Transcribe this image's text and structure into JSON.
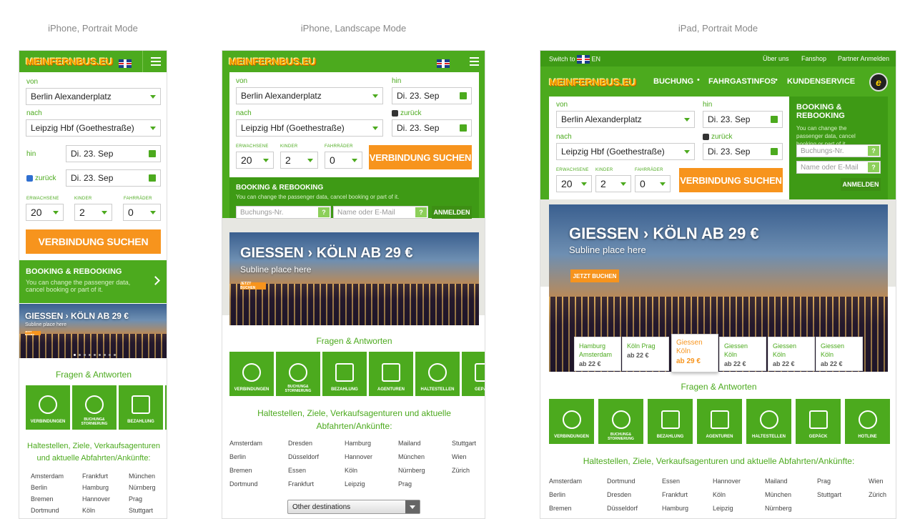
{
  "captions": {
    "p1": "iPhone, Portrait Mode",
    "p2": "iPhone, Landscape Mode",
    "p3": "iPad, Portrait Mode"
  },
  "logo": "MEINFERNBUS.EU",
  "form": {
    "von": "von",
    "nach": "nach",
    "hin": "hin",
    "zurueck": "zurück",
    "from_value": "Berlin Alexanderplatz",
    "to_value": "Leipzig Hbf (Goethestraße)",
    "date_out": "Di. 23. Sep",
    "date_back": "Di. 23. Sep",
    "adults_label": "ERWACHSENE",
    "kids_label": "KINDER",
    "bikes_label": "FAHRRÄDER",
    "adults": "20",
    "kids": "2",
    "bikes": "0",
    "search": "VERBINDUNG SUCHEN"
  },
  "booking": {
    "title": "BOOKING & REBOOKING",
    "text_long": "You can change the passenger data, cancel booking or part of it.",
    "text_p1a": "You can change the passenger data,",
    "text_p1b": "cancel booking or part of it.",
    "text_p3a": "You can change the",
    "text_p3b": "passenger data, cancel",
    "text_p3c": "booking or part of it.",
    "nr_ph": "Buchungs-Nr.",
    "name_ph": "Name oder E-Mail",
    "login": "ANMELDEN",
    "q": "?"
  },
  "hero": {
    "title": "GIESSEN › KÖLN",
    "price": "AB 29 €",
    "sub": "Subline place here",
    "cta": "JETZT BUCHEN"
  },
  "faq": "Fragen & Antworten",
  "tiles": [
    "VERBINDUNGEN",
    "BUCHUNG& STORNIERUNG",
    "BEZAHLUNG",
    "AGENTUREN",
    "HALTESTELLEN",
    "GEPÄCK",
    "HOTLINE"
  ],
  "stations_title": "Haltestellen, Ziele, Verkaufsagenturen und aktuelle Abfahrten/Ankünfte:",
  "stations_title_a": "Haltestellen, Ziele, Verkaufsagenturen und aktuelle",
  "stations_title_b": "Abfahrten/Ankünfte:",
  "stations_title_p1a": "Haltestellen, Ziele, Verkaufsagenturen",
  "stations_title_p1b": "und aktuelle Abfahrten/Ankünfte:",
  "dest_p1": [
    [
      "Amsterdam",
      "Frankfurt",
      "München"
    ],
    [
      "Berlin",
      "Hamburg",
      "Nürnberg"
    ],
    [
      "Bremen",
      "Hannover",
      "Prag"
    ],
    [
      "Dortmund",
      "Köln",
      "Stuttgart"
    ]
  ],
  "dest_p2": [
    [
      "Amsterdam",
      "Dresden",
      "Hamburg",
      "Mailand",
      "Stuttgart"
    ],
    [
      "Berlin",
      "Düsseldorf",
      "Hannover",
      "München",
      "Wien"
    ],
    [
      "Bremen",
      "Essen",
      "Köln",
      "Nürnberg",
      "Zürich"
    ],
    [
      "Dortmund",
      "Frankfurt",
      "Leipzig",
      "Prag",
      ""
    ]
  ],
  "dest_p3": [
    [
      "Amsterdam",
      "Dortmund",
      "Essen",
      "Hannover",
      "Mailand",
      "Prag",
      "Wien"
    ],
    [
      "Berlin",
      "Dresden",
      "Frankfurt",
      "Köln",
      "München",
      "Stuttgart",
      "Zürich"
    ],
    [
      "Bremen",
      "Düsseldorf",
      "Hamburg",
      "Leipzig",
      "Nürnberg",
      "",
      ""
    ]
  ],
  "other_destinations": "Other destinations",
  "ipad_top": {
    "switch": "Switch to",
    "lang": "EN",
    "links": [
      "Über uns",
      "Fanshop",
      "Partner Anmelden"
    ]
  },
  "ipad_nav": [
    "BUCHUNG",
    "FAHRGASTINFOS",
    "KUNDENSERVICE"
  ],
  "ipad_badge": "e",
  "price_cards": [
    {
      "route": "Hamburg Amsterdam",
      "price": "ab 22 €"
    },
    {
      "route": "Köln Prag",
      "price": "ab 22 €"
    },
    {
      "route": "Giessen Köln",
      "price": "ab 29 €"
    },
    {
      "route": "Giessen Köln",
      "price": "ab 22 €"
    },
    {
      "route": "Giessen Köln",
      "price": "ab 22 €"
    },
    {
      "route": "Giessen Köln",
      "price": "ab 22 €"
    }
  ]
}
